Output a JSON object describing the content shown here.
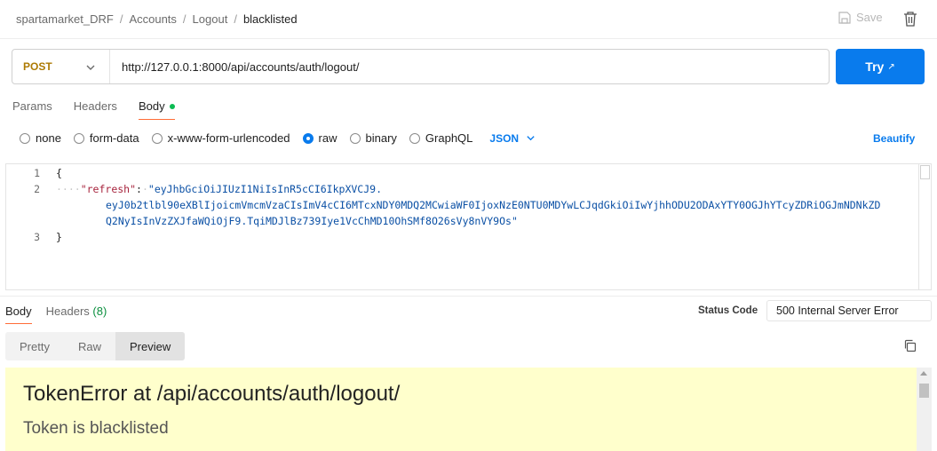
{
  "breadcrumb": {
    "items": [
      "spartamarket_DRF",
      "Accounts",
      "Logout"
    ],
    "current": "blacklisted",
    "separator": "/"
  },
  "header": {
    "save_label": "Save",
    "icons": [
      "save-icon",
      "trash-icon"
    ]
  },
  "request": {
    "method": "POST",
    "url": "http://127.0.0.1:8000/api/accounts/auth/logout/",
    "try_label": "Try",
    "try_arrow": "↗",
    "tabs": [
      {
        "label": "Params"
      },
      {
        "label": "Headers"
      },
      {
        "label": "Body"
      }
    ],
    "body_options": [
      {
        "label": "none",
        "checked": false
      },
      {
        "label": "form-data",
        "checked": false
      },
      {
        "label": "x-www-form-urlencoded",
        "checked": false
      },
      {
        "label": "raw",
        "checked": true
      },
      {
        "label": "binary",
        "checked": false
      },
      {
        "label": "GraphQL",
        "checked": false
      }
    ],
    "format": "JSON",
    "beautify_label": "Beautify"
  },
  "editor": {
    "line_numbers": [
      "1",
      "2",
      "3"
    ],
    "open_brace": "{",
    "key": "\"refresh\"",
    "colon": ":",
    "value_line1": "\"eyJhbGciOiJIUzI1NiIsInR5cCI6IkpXVCJ9.",
    "value_line2": "eyJ0b2tlbl90eXBlIjoicmVmcmVzaCIsImV4cCI6MTcxNDY0MDQ2MCwiaWF0IjoxNzE0NTU0MDYwLCJqdGkiOiIwYjhhODU2ODAxYTY0OGJhYTcyZDRiOGJmNDNkZD",
    "value_line3": "Q2NyIsInVzZXJfaWQiOjF9.TqiMDJlBz739Iye1VcChMD10OhSMf8O26sVy8nVY9Os\"",
    "close_brace": "}"
  },
  "response": {
    "tabs": [
      {
        "label": "Body"
      },
      {
        "label": "Headers",
        "count": "(8)"
      }
    ],
    "status_label": "Status Code",
    "status_value": "500 Internal Server Error",
    "view_tabs": [
      {
        "label": "Pretty"
      },
      {
        "label": "Raw"
      },
      {
        "label": "Preview"
      }
    ],
    "error_title": "TokenError at /api/accounts/auth/logout/",
    "error_message": "Token is blacklisted"
  },
  "colors": {
    "accent": "#097bed",
    "method": "#ad7a03",
    "active_tab": "#ff6c37",
    "body_dot": "#0cbb52",
    "preview_bg": "#ffffcc"
  }
}
